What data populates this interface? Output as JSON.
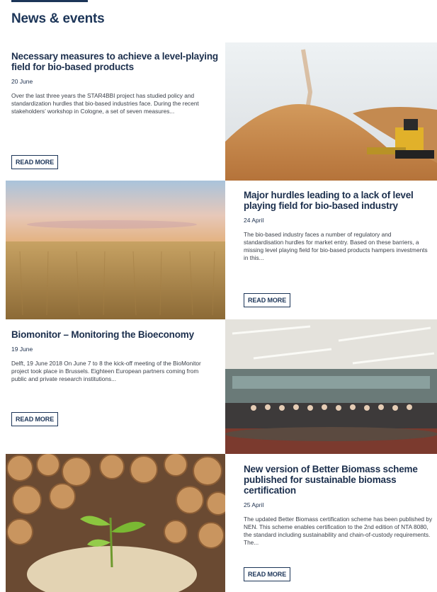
{
  "section": {
    "title": "News & events"
  },
  "articles": [
    {
      "title": "Necessary measures to achieve a level-playing field for bio-based products",
      "date": "20 June",
      "excerpt": "Over the last three years the STAR4BBI project has studied policy and standardization hurdles that bio-based industries face. During the recent stakeholders’ workshop in Cologne, a set of seven measures...",
      "cta": "READ MORE",
      "image": "sawdust-pile-with-bulldozer"
    },
    {
      "title": "Major hurdles leading to a lack of level playing field for bio-based industry",
      "date": "24 April",
      "excerpt": "The bio-based industry faces a number of regulatory and standardisation hurdles for market entry. Based on these barriers, a missing level playing field for bio-based products hampers investments in this...",
      "cta": "READ MORE",
      "image": "wheat-field-at-sunset"
    },
    {
      "title": "Biomonitor – Monitoring the Bioeconomy",
      "date": "19 June",
      "excerpt": "Delft, 19 June 2018 On June 7 to 8 the kick-off meeting of the BioMonitor project took place in Brussels. Eighteen European partners coming from public and private research institutions...",
      "cta": "READ MORE",
      "image": "group-photo-in-meeting-room"
    },
    {
      "title": "New version of Better Biomass scheme published for sustainable biomass certification",
      "date": "25 April",
      "excerpt": "The updated Better Biomass certification scheme has been published by NEN. This scheme enables certification to the 2nd edition of NTA 8080, the standard including sustainability and chain-of-custody requirements. The...",
      "cta": "READ MORE",
      "image": "wood-logs-pellets-and-seedling"
    }
  ]
}
